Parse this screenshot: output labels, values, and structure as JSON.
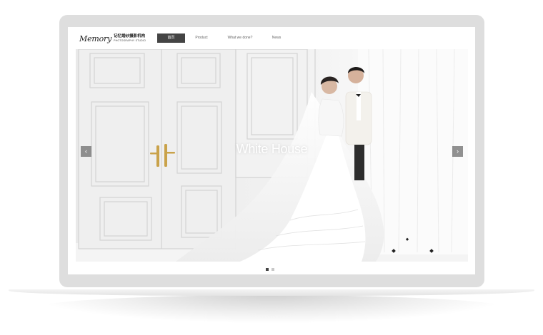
{
  "logo": {
    "script": "Memory",
    "chinese": "记忆婚纱摄影机构",
    "english": "PHOTOGRAPHY STUDIO"
  },
  "nav": {
    "items": [
      {
        "label": "首页",
        "active": true
      },
      {
        "label": "Product",
        "active": false
      },
      {
        "label": "What we done?",
        "active": false
      },
      {
        "label": "News",
        "active": false
      }
    ]
  },
  "hero": {
    "title": "White House",
    "prev_icon": "chevron-left-icon",
    "next_icon": "chevron-right-icon",
    "slides": 2,
    "active_slide": 1
  },
  "colors": {
    "frame": "#dedede",
    "nav_active_bg": "#444444",
    "arrow_bg": "#6e6e6e"
  }
}
